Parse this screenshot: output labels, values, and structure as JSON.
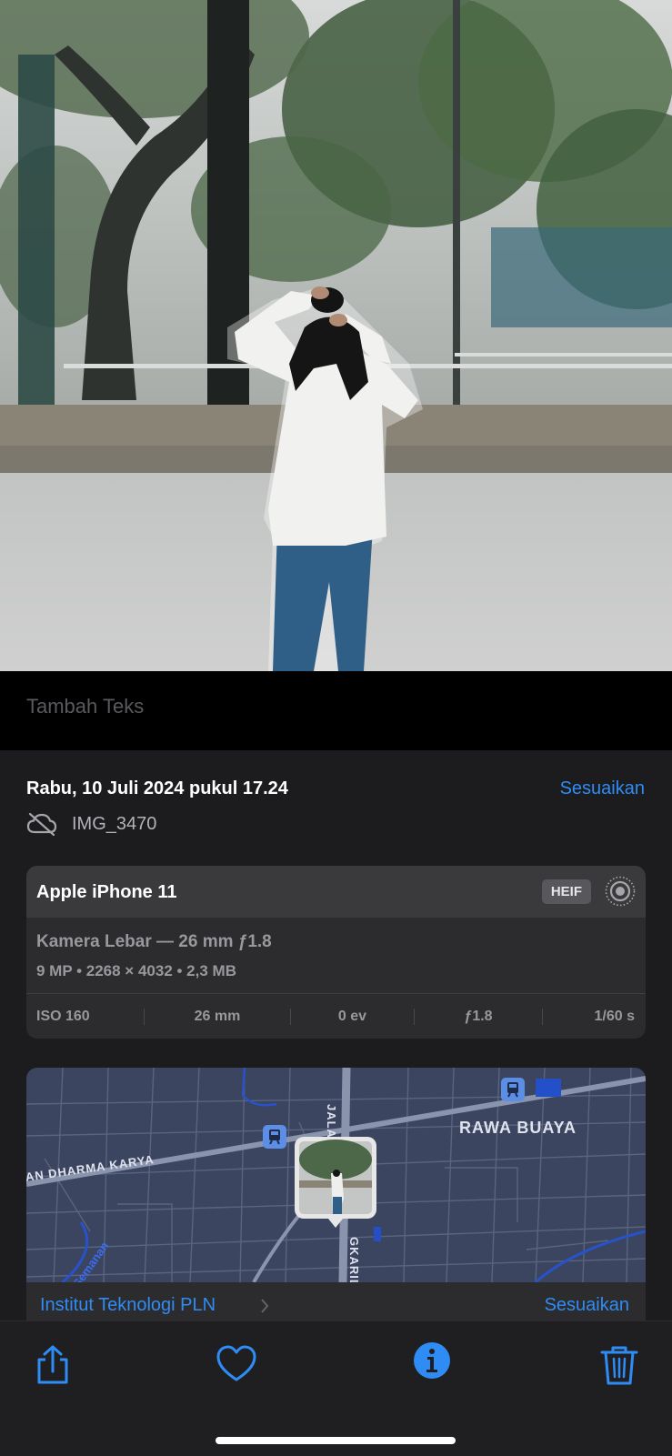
{
  "photo": {
    "description_icon": "photo-main"
  },
  "caption": {
    "placeholder": "Tambah Teks"
  },
  "info": {
    "date": "Rabu, 10 Juli 2024 pukul 17.24",
    "adjust_label": "Sesuaikan",
    "filename": "IMG_3470"
  },
  "camera": {
    "device": "Apple iPhone 11",
    "format_badge": "HEIF",
    "lens": "Kamera Lebar — 26 mm ƒ1.8",
    "specs": "9 MP  •  2268 × 4032  •  2,3 MB",
    "exif": {
      "iso": "ISO 160",
      "focal": "26 mm",
      "ev": "0 ev",
      "aperture": "ƒ1.8",
      "shutter": "1/60 s"
    }
  },
  "map": {
    "labels": {
      "rawa_buaya": "RAWA BUAYA",
      "dharma_karya": "AN DHARMA KARYA",
      "jala": "JALA",
      "gkarili": "GKARILI",
      "semanan": "Semanan"
    },
    "location_name": "Institut Teknologi PLN",
    "adjust_label": "Sesuaikan"
  },
  "toolbar": {
    "share": "share-icon",
    "favorite": "heart-icon",
    "info": "info-icon",
    "delete": "trash-icon"
  },
  "colors": {
    "accent": "#2f8cf5",
    "background": "#1c1c1e"
  }
}
